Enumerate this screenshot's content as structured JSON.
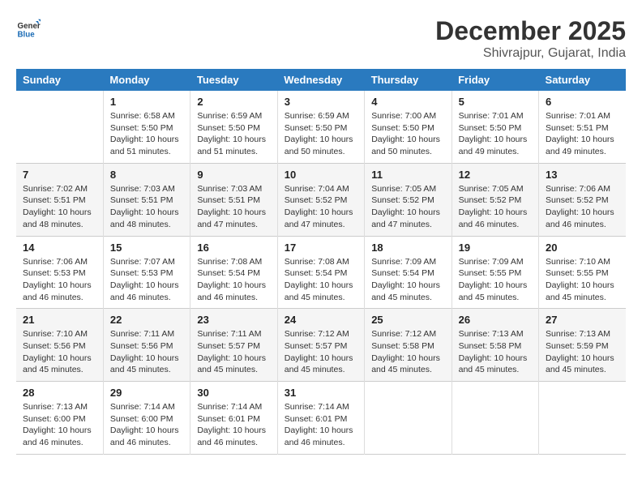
{
  "header": {
    "logo_line1": "General",
    "logo_line2": "Blue",
    "month": "December 2025",
    "location": "Shivrajpur, Gujarat, India"
  },
  "weekdays": [
    "Sunday",
    "Monday",
    "Tuesday",
    "Wednesday",
    "Thursday",
    "Friday",
    "Saturday"
  ],
  "weeks": [
    [
      {
        "day": "",
        "info": ""
      },
      {
        "day": "1",
        "info": "Sunrise: 6:58 AM\nSunset: 5:50 PM\nDaylight: 10 hours\nand 51 minutes."
      },
      {
        "day": "2",
        "info": "Sunrise: 6:59 AM\nSunset: 5:50 PM\nDaylight: 10 hours\nand 51 minutes."
      },
      {
        "day": "3",
        "info": "Sunrise: 6:59 AM\nSunset: 5:50 PM\nDaylight: 10 hours\nand 50 minutes."
      },
      {
        "day": "4",
        "info": "Sunrise: 7:00 AM\nSunset: 5:50 PM\nDaylight: 10 hours\nand 50 minutes."
      },
      {
        "day": "5",
        "info": "Sunrise: 7:01 AM\nSunset: 5:50 PM\nDaylight: 10 hours\nand 49 minutes."
      },
      {
        "day": "6",
        "info": "Sunrise: 7:01 AM\nSunset: 5:51 PM\nDaylight: 10 hours\nand 49 minutes."
      }
    ],
    [
      {
        "day": "7",
        "info": "Sunrise: 7:02 AM\nSunset: 5:51 PM\nDaylight: 10 hours\nand 48 minutes."
      },
      {
        "day": "8",
        "info": "Sunrise: 7:03 AM\nSunset: 5:51 PM\nDaylight: 10 hours\nand 48 minutes."
      },
      {
        "day": "9",
        "info": "Sunrise: 7:03 AM\nSunset: 5:51 PM\nDaylight: 10 hours\nand 47 minutes."
      },
      {
        "day": "10",
        "info": "Sunrise: 7:04 AM\nSunset: 5:52 PM\nDaylight: 10 hours\nand 47 minutes."
      },
      {
        "day": "11",
        "info": "Sunrise: 7:05 AM\nSunset: 5:52 PM\nDaylight: 10 hours\nand 47 minutes."
      },
      {
        "day": "12",
        "info": "Sunrise: 7:05 AM\nSunset: 5:52 PM\nDaylight: 10 hours\nand 46 minutes."
      },
      {
        "day": "13",
        "info": "Sunrise: 7:06 AM\nSunset: 5:52 PM\nDaylight: 10 hours\nand 46 minutes."
      }
    ],
    [
      {
        "day": "14",
        "info": "Sunrise: 7:06 AM\nSunset: 5:53 PM\nDaylight: 10 hours\nand 46 minutes."
      },
      {
        "day": "15",
        "info": "Sunrise: 7:07 AM\nSunset: 5:53 PM\nDaylight: 10 hours\nand 46 minutes."
      },
      {
        "day": "16",
        "info": "Sunrise: 7:08 AM\nSunset: 5:54 PM\nDaylight: 10 hours\nand 46 minutes."
      },
      {
        "day": "17",
        "info": "Sunrise: 7:08 AM\nSunset: 5:54 PM\nDaylight: 10 hours\nand 45 minutes."
      },
      {
        "day": "18",
        "info": "Sunrise: 7:09 AM\nSunset: 5:54 PM\nDaylight: 10 hours\nand 45 minutes."
      },
      {
        "day": "19",
        "info": "Sunrise: 7:09 AM\nSunset: 5:55 PM\nDaylight: 10 hours\nand 45 minutes."
      },
      {
        "day": "20",
        "info": "Sunrise: 7:10 AM\nSunset: 5:55 PM\nDaylight: 10 hours\nand 45 minutes."
      }
    ],
    [
      {
        "day": "21",
        "info": "Sunrise: 7:10 AM\nSunset: 5:56 PM\nDaylight: 10 hours\nand 45 minutes."
      },
      {
        "day": "22",
        "info": "Sunrise: 7:11 AM\nSunset: 5:56 PM\nDaylight: 10 hours\nand 45 minutes."
      },
      {
        "day": "23",
        "info": "Sunrise: 7:11 AM\nSunset: 5:57 PM\nDaylight: 10 hours\nand 45 minutes."
      },
      {
        "day": "24",
        "info": "Sunrise: 7:12 AM\nSunset: 5:57 PM\nDaylight: 10 hours\nand 45 minutes."
      },
      {
        "day": "25",
        "info": "Sunrise: 7:12 AM\nSunset: 5:58 PM\nDaylight: 10 hours\nand 45 minutes."
      },
      {
        "day": "26",
        "info": "Sunrise: 7:13 AM\nSunset: 5:58 PM\nDaylight: 10 hours\nand 45 minutes."
      },
      {
        "day": "27",
        "info": "Sunrise: 7:13 AM\nSunset: 5:59 PM\nDaylight: 10 hours\nand 45 minutes."
      }
    ],
    [
      {
        "day": "28",
        "info": "Sunrise: 7:13 AM\nSunset: 6:00 PM\nDaylight: 10 hours\nand 46 minutes."
      },
      {
        "day": "29",
        "info": "Sunrise: 7:14 AM\nSunset: 6:00 PM\nDaylight: 10 hours\nand 46 minutes."
      },
      {
        "day": "30",
        "info": "Sunrise: 7:14 AM\nSunset: 6:01 PM\nDaylight: 10 hours\nand 46 minutes."
      },
      {
        "day": "31",
        "info": "Sunrise: 7:14 AM\nSunset: 6:01 PM\nDaylight: 10 hours\nand 46 minutes."
      },
      {
        "day": "",
        "info": ""
      },
      {
        "day": "",
        "info": ""
      },
      {
        "day": "",
        "info": ""
      }
    ]
  ]
}
